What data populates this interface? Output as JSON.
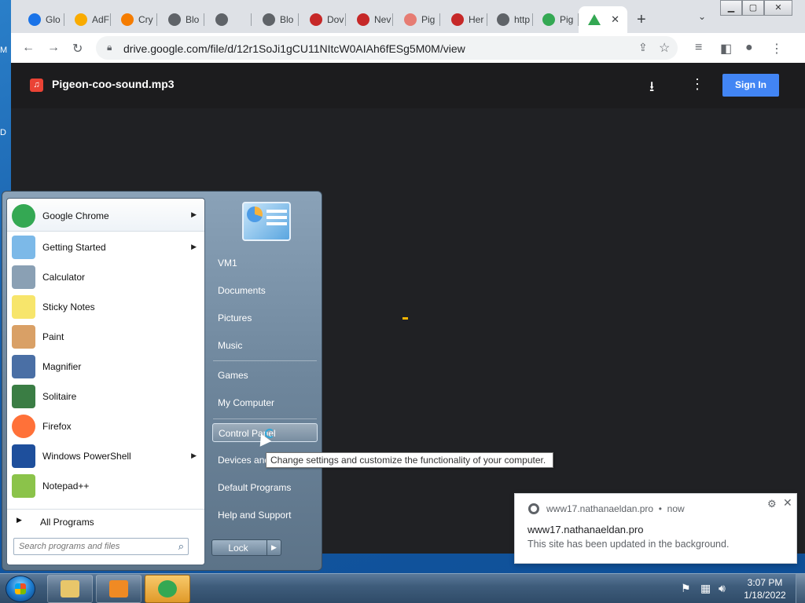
{
  "desktop": {
    "edge_letters": [
      "M",
      "D"
    ]
  },
  "browser": {
    "tabs": [
      {
        "title": "Glo",
        "color": "#1a73e8"
      },
      {
        "title": "AdF",
        "color": "#f9ab00"
      },
      {
        "title": "Cry",
        "color": "#f57c00"
      },
      {
        "title": "Blo",
        "color": "#5f6368"
      },
      {
        "title": "",
        "color": "#5f6368"
      },
      {
        "title": "Blo",
        "color": "#5f6368"
      },
      {
        "title": "Dov",
        "color": "#c62828"
      },
      {
        "title": "Nev",
        "color": "#c62828"
      },
      {
        "title": "Pig",
        "color": "#e67c73"
      },
      {
        "title": "Her",
        "color": "#c62828"
      },
      {
        "title": "http",
        "color": "#5f6368"
      },
      {
        "title": "Pig",
        "color": "#34a853"
      }
    ],
    "active_tab": {
      "icon": "google-drive-icon",
      "close_label": "✕"
    },
    "new_tab_label": "+",
    "url": "drive.google.com/file/d/12r1SoJi1gCU11NItcW0AIAh6fESg5M0M/view"
  },
  "viewer": {
    "file_name": "Pigeon-coo-sound.mp3",
    "sign_in_label": "Sign In",
    "accent": "#4285f4"
  },
  "start_menu": {
    "programs": [
      {
        "label": "Google Chrome",
        "has_submenu": true,
        "icon": "chrome-icon",
        "color": "#34a853"
      },
      {
        "label": "Getting Started",
        "has_submenu": true,
        "icon": "getting-started-icon",
        "color": "#7cb9e8"
      },
      {
        "label": "Calculator",
        "has_submenu": false,
        "icon": "calculator-icon",
        "color": "#8aa0b4"
      },
      {
        "label": "Sticky Notes",
        "has_submenu": false,
        "icon": "sticky-notes-icon",
        "color": "#f7e56b"
      },
      {
        "label": "Paint",
        "has_submenu": false,
        "icon": "paint-icon",
        "color": "#d9a066"
      },
      {
        "label": "Magnifier",
        "has_submenu": false,
        "icon": "magnifier-icon",
        "color": "#4a6fa5"
      },
      {
        "label": "Solitaire",
        "has_submenu": false,
        "icon": "solitaire-icon",
        "color": "#3a7d44"
      },
      {
        "label": "Firefox",
        "has_submenu": false,
        "icon": "firefox-icon",
        "color": "#ff7139"
      },
      {
        "label": "Windows PowerShell",
        "has_submenu": true,
        "icon": "powershell-icon",
        "color": "#1e4f9c"
      },
      {
        "label": "Notepad++",
        "has_submenu": false,
        "icon": "notepad-plus-plus-icon",
        "color": "#8bc34a"
      }
    ],
    "all_programs_label": "All Programs",
    "search_placeholder": "Search programs and files",
    "right_items": [
      {
        "label": "VM1"
      },
      {
        "label": "Documents"
      },
      {
        "label": "Pictures"
      },
      {
        "label": "Music"
      },
      {
        "label": "Games"
      },
      {
        "label": "My Computer"
      },
      {
        "label": "Control Panel"
      },
      {
        "label": "Devices and Printers"
      },
      {
        "label": "Default Programs"
      },
      {
        "label": "Help and Support"
      }
    ],
    "selected_item": "Control Panel",
    "lock_label": "Lock"
  },
  "tooltip": {
    "text": "Change settings and customize the functionality of your computer."
  },
  "notification": {
    "source": "www17.nathanaeldan.pro",
    "time": "now",
    "title": "www17.nathanaeldan.pro",
    "body": "This site has been updated in the background."
  },
  "taskbar": {
    "time": "3:07 PM",
    "date": "1/18/2022",
    "apps": [
      {
        "name": "explorer",
        "color": "#e8c66a"
      },
      {
        "name": "media-player",
        "color": "#f08a24"
      },
      {
        "name": "chrome",
        "color": "#34a853"
      }
    ]
  }
}
